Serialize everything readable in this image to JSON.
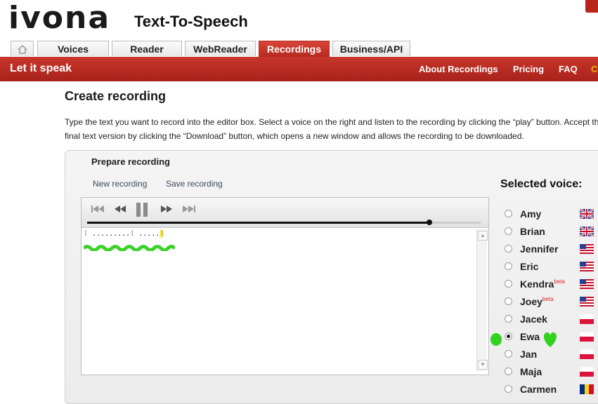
{
  "header": {
    "logo": "ivona",
    "title": "Text-To-Speech"
  },
  "tabs": [
    {
      "label": "Voices",
      "active": false
    },
    {
      "label": "Reader",
      "active": false
    },
    {
      "label": "WebReader",
      "active": false
    },
    {
      "label": "Recordings",
      "active": true
    },
    {
      "label": "Business/API",
      "active": false
    }
  ],
  "redbar": {
    "tagline": "Let it speak",
    "links": [
      "About Recordings",
      "Pricing",
      "FAQ",
      "C"
    ]
  },
  "page": {
    "title": "Create recording",
    "intro_line1": "Type the text you want to record into the editor box. Select a voice on the right and listen to the recording by clicking the “play” button. Accept th",
    "intro_line2": "final text version by clicking the “Download” button, which opens a new window and allows the recording to be downloaded."
  },
  "panel": {
    "title": "Prepare recording",
    "new_recording": "New recording",
    "save_recording": "Save recording",
    "editor_line1": "⁞ .........⁞ .....⁞",
    "progress": 0.87
  },
  "voices": {
    "title": "Selected voice:",
    "items": [
      {
        "name": "Amy",
        "beta": "",
        "flag": "uk",
        "selected": false
      },
      {
        "name": "Brian",
        "beta": "",
        "flag": "uk",
        "selected": false
      },
      {
        "name": "Jennifer",
        "beta": "",
        "flag": "us",
        "selected": false
      },
      {
        "name": "Eric",
        "beta": "",
        "flag": "us",
        "selected": false
      },
      {
        "name": "Kendra",
        "beta": "beta",
        "flag": "us",
        "selected": false
      },
      {
        "name": "Joey",
        "beta": "beta",
        "flag": "us",
        "selected": false
      },
      {
        "name": "Jacek",
        "beta": "",
        "flag": "pl",
        "selected": false
      },
      {
        "name": "Ewa",
        "beta": "",
        "flag": "pl",
        "selected": true
      },
      {
        "name": "Jan",
        "beta": "",
        "flag": "pl",
        "selected": false
      },
      {
        "name": "Maja",
        "beta": "",
        "flag": "pl",
        "selected": false
      },
      {
        "name": "Carmen",
        "beta": "",
        "flag": "ro",
        "selected": false
      }
    ]
  },
  "colors": {
    "brand_red": "#b8261b",
    "link": "#3b4a5c"
  },
  "icons": [
    "home-icon",
    "skip-back-icon",
    "rewind-icon",
    "pause-icon",
    "forward-icon",
    "skip-forward-icon"
  ]
}
